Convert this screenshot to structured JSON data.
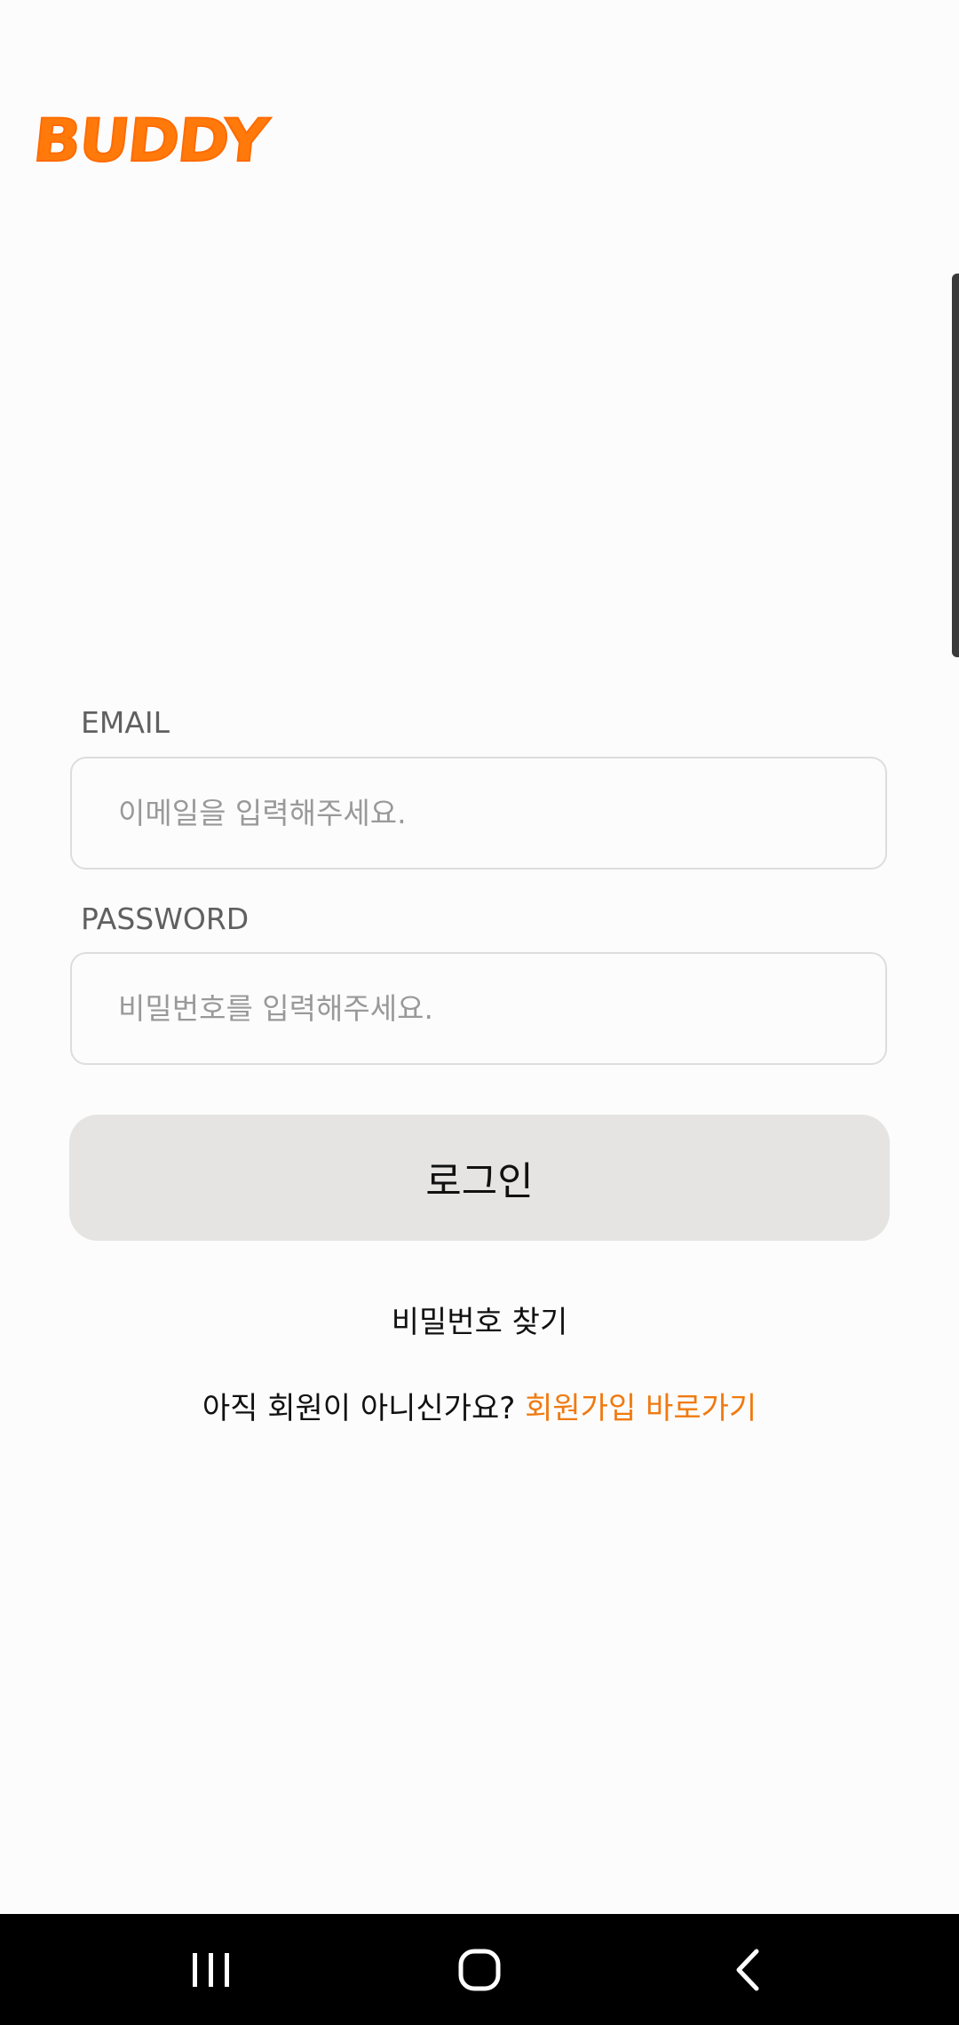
{
  "app": {
    "logo_text": "BUDDY",
    "brand_color": "#ff7a0a"
  },
  "login_form": {
    "email_label": "EMAIL",
    "email_placeholder": "이메일을 입력해주세요.",
    "email_value": "",
    "password_label": "PASSWORD",
    "password_placeholder": "비밀번호를 입력해주세요.",
    "password_value": "",
    "login_button_label": "로그인",
    "login_button_color": "#e5e4e2"
  },
  "links": {
    "find_password": "비밀번호 찾기",
    "signup_prompt": "아직 회원이 아니신가요?",
    "signup_link": "회원가입 바로가기",
    "signup_link_color": "#f07a10"
  },
  "system_nav": {
    "buttons": [
      {
        "name": "recent-apps",
        "icon": "recent-apps-icon"
      },
      {
        "name": "home",
        "icon": "home-icon"
      },
      {
        "name": "back",
        "icon": "back-icon"
      }
    ]
  }
}
